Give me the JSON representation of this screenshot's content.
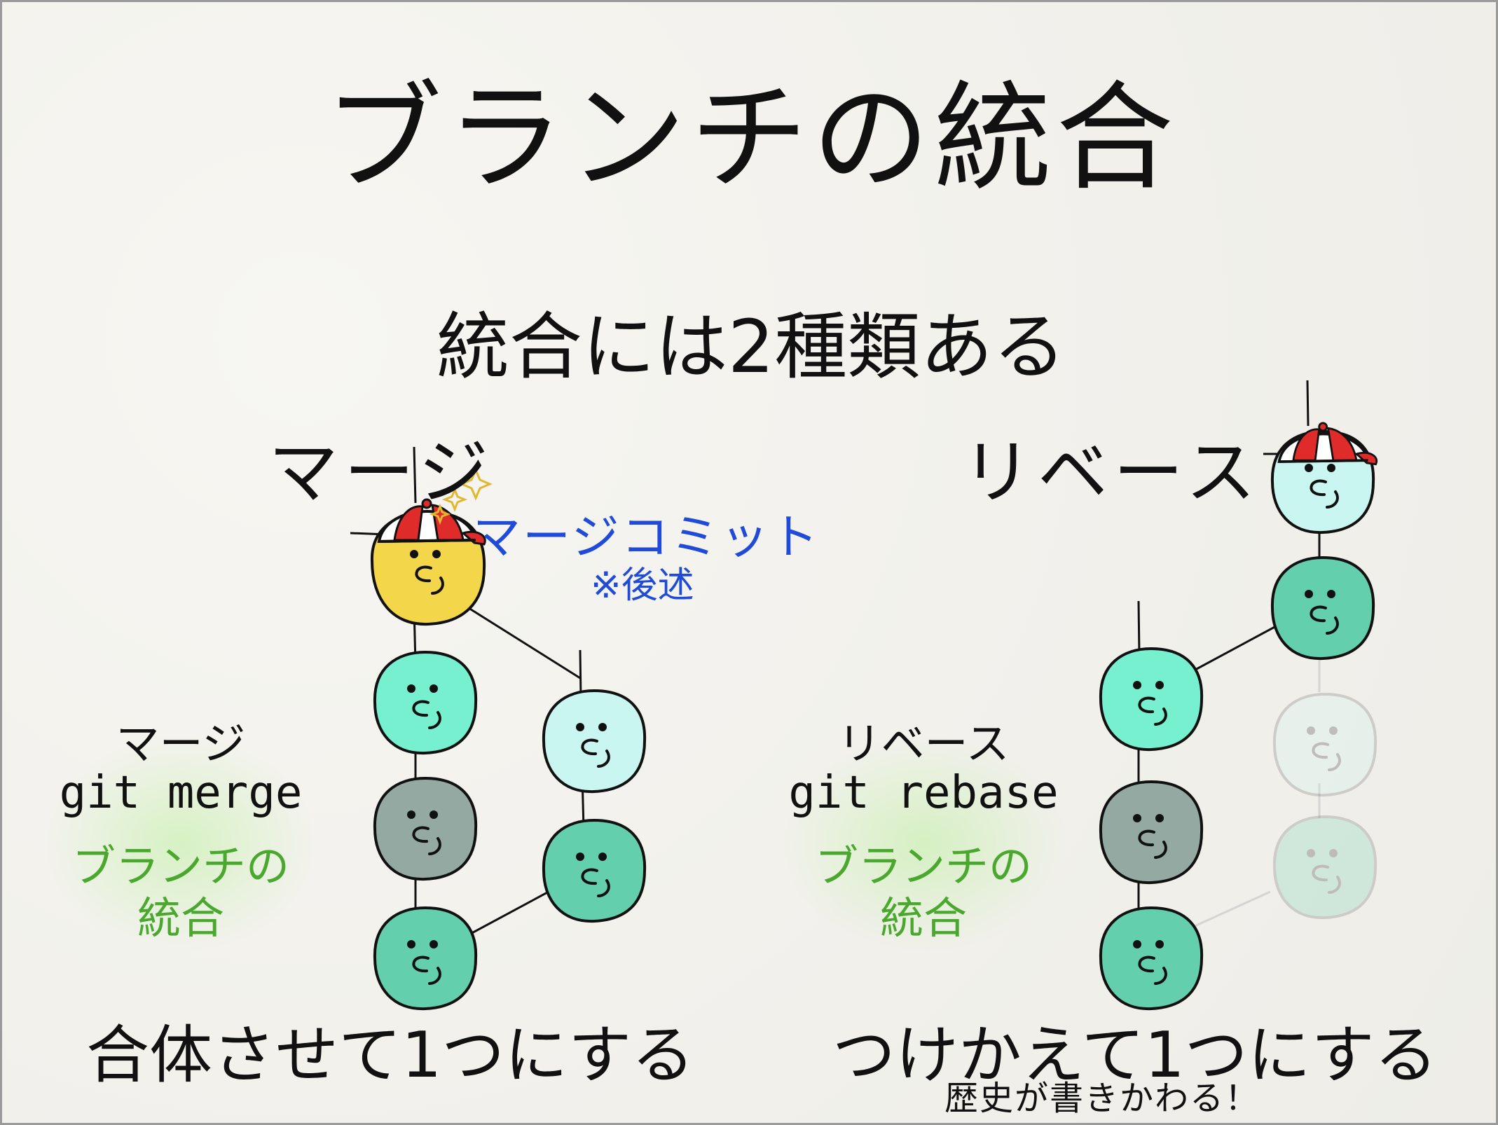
{
  "title": "ブランチの統合",
  "subtitle": "統合には2種類ある",
  "merge": {
    "heading": "マージ",
    "label_jp": "マージ",
    "label_cmd": "git merge",
    "category_line1": "ブランチの",
    "category_line2": "統合",
    "merge_commit_label": "マージコミット",
    "merge_commit_note": "※後述",
    "description": "合体させて1つにする"
  },
  "rebase": {
    "heading": "リベース",
    "label_jp": "リベース",
    "label_cmd": "git rebase",
    "category_line1": "ブランチの",
    "category_line2": "統合",
    "description": "つけかえて1つにする",
    "note": "歴史が書きかわる！"
  },
  "colors": {
    "main_commit": "#77f0cf",
    "gray_commit": "#93a9a2",
    "teal_commit": "#63cfac",
    "light_commit": "#c9f6f1",
    "merge_commit": "#f4d64a",
    "accent_blue": "#1f4bd8",
    "accent_green": "#4aa82e",
    "cap_red": "#e02b2b"
  }
}
